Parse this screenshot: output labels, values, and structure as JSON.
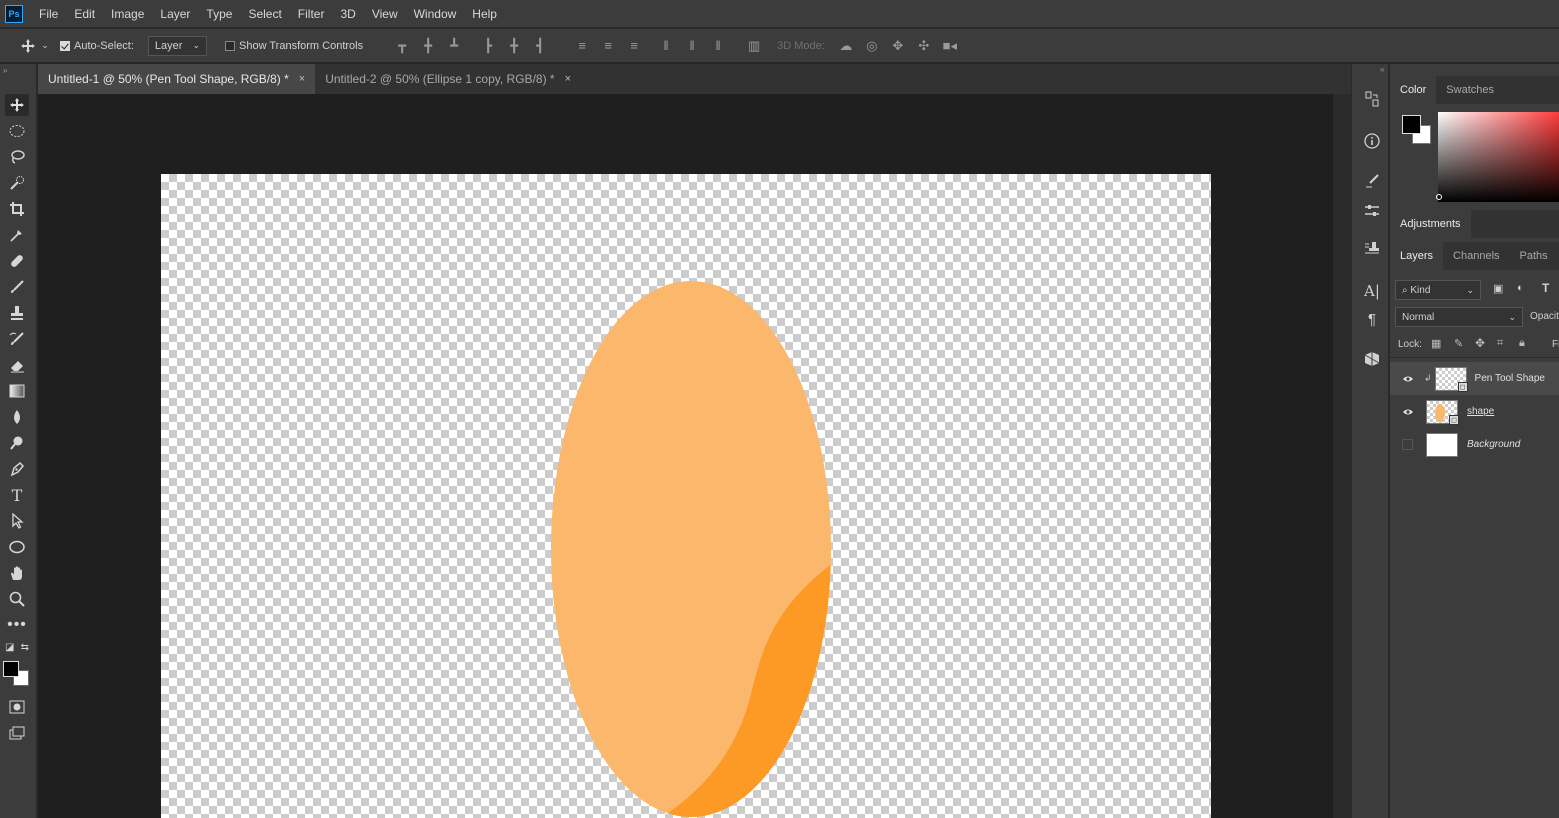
{
  "app": {
    "logo": "Ps"
  },
  "menu": [
    "File",
    "Edit",
    "Image",
    "Layer",
    "Type",
    "Select",
    "Filter",
    "3D",
    "View",
    "Window",
    "Help"
  ],
  "options": {
    "auto_select_label": "Auto-Select:",
    "auto_select_checked": true,
    "auto_select_value": "Layer",
    "show_transform_label": "Show Transform Controls",
    "show_transform_checked": false,
    "three_d_mode_label": "3D Mode:"
  },
  "tabs": [
    {
      "label": "Untitled-1 @ 50% (Pen Tool Shape, RGB/8) *",
      "active": true
    },
    {
      "label": "Untitled-2 @ 50% (Ellipse 1 copy, RGB/8) *",
      "active": false
    }
  ],
  "tab_close_glyph": "×",
  "canvas": {
    "ellipse_color": "#fbb86c",
    "shape_color": "#fd9a25"
  },
  "color_panel": {
    "tabs": [
      "Color",
      "Swatches"
    ],
    "foreground": "#000000",
    "background": "#ffffff"
  },
  "adjustments_label": "Adjustments",
  "layers_panel": {
    "tabs": [
      "Layers",
      "Channels",
      "Paths"
    ],
    "kind_label": "Kind",
    "blend_mode": "Normal",
    "opacity_label": "Opacity",
    "lock_label": "Lock:",
    "fill_label": "Fi",
    "layers": [
      {
        "name": "Pen Tool Shape",
        "visible": true,
        "selected": true
      },
      {
        "name": "shape",
        "visible": true,
        "selected": false
      },
      {
        "name": "Background",
        "visible": false,
        "selected": false
      }
    ]
  },
  "icons": {
    "move": "move-icon",
    "marquee": "elliptical-marquee-icon",
    "lasso": "lasso-icon",
    "quick_select": "quick-selection-icon",
    "crop": "crop-icon",
    "eyedropper": "eyedropper-icon",
    "healing": "healing-brush-icon",
    "brush": "brush-icon",
    "stamp": "clone-stamp-icon",
    "history_brush": "history-brush-icon",
    "eraser": "eraser-icon",
    "gradient": "gradient-icon",
    "blur": "blur-icon",
    "dodge": "dodge-icon",
    "pen": "pen-icon",
    "type": "type-icon",
    "path_select": "path-selection-icon",
    "ellipse": "ellipse-tool-icon",
    "hand": "hand-icon",
    "zoom": "zoom-icon",
    "more": "more-tools-icon"
  }
}
